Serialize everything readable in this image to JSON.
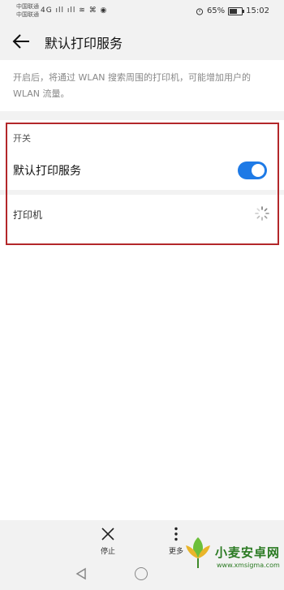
{
  "status_bar": {
    "carrier_1": "中国联通",
    "carrier_2": "中国联通",
    "network_icons": "4G ıll ıll ≋ ⌘ ◉",
    "battery_percent": "65%",
    "time": "15:02"
  },
  "header": {
    "back_icon": "arrow-left",
    "title": "默认打印服务"
  },
  "description": "开启后，将通过 WLAN 搜索周围的打印机，可能增加用户的 WLAN 流量。",
  "switch_section": {
    "heading": "开关",
    "item_label": "默认打印服务",
    "toggle_on": true,
    "toggle_color": "#1e7ae6"
  },
  "printers_section": {
    "heading": "打印机",
    "loading_icon": "spinner"
  },
  "highlight_color": "#b3272a",
  "bottom_actions": [
    {
      "label": "停止",
      "icon": "close-x"
    },
    {
      "label": "更多",
      "icon": "more-vertical"
    }
  ],
  "nav_bar": {
    "icons": [
      "triangle-back",
      "circle-home"
    ]
  },
  "watermark": {
    "title": "小麦安卓网",
    "url": "www.xmsigma.com"
  }
}
